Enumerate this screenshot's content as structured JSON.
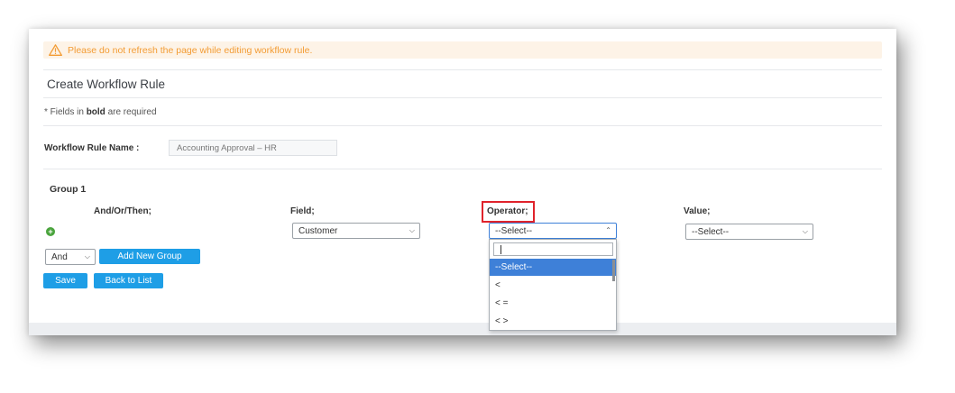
{
  "warning": {
    "text": "Please do not refresh the page while editing workflow rule."
  },
  "page": {
    "title": "Create Workflow Rule"
  },
  "required_note": {
    "prefix": "* Fields in",
    "bold": "bold",
    "suffix": "are required"
  },
  "rule_name": {
    "label": "Workflow Rule Name :",
    "value": "Accounting Approval – HR"
  },
  "group": {
    "title": "Group 1",
    "columns": {
      "and_or_then": "And/Or/Then;",
      "field": "Field;",
      "operator": "Operator;",
      "value": "Value;"
    },
    "field_select": "Customer",
    "operator_select": "--Select--",
    "value_select": "--Select--"
  },
  "logic_select": "And",
  "buttons": {
    "add_group": "Add New Group",
    "save": "Save",
    "back": "Back to List"
  },
  "operator_dropdown": {
    "search_value": "",
    "options": [
      "--Select--",
      "<",
      "< =",
      "< >"
    ],
    "highlighted": "--Select--"
  },
  "colors": {
    "accent": "#1e9ee6",
    "warning": "#f39c34",
    "highlight": "#3e80d8",
    "focus_box": "#e0232b"
  }
}
